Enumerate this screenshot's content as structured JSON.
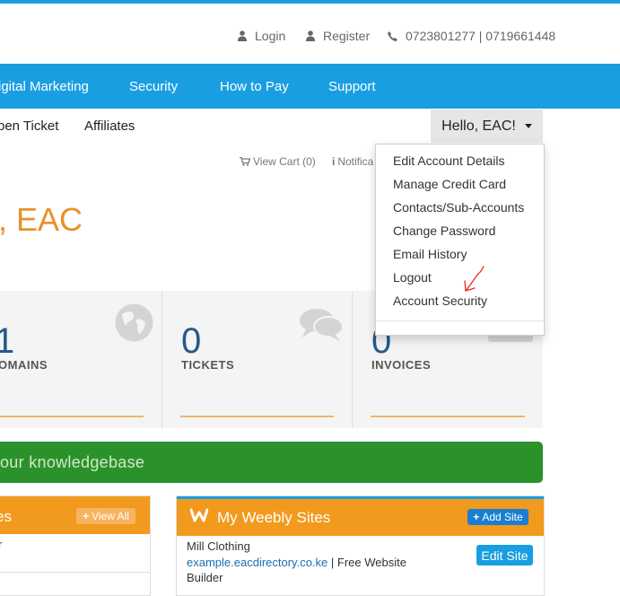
{
  "top_links": {
    "login": "Login",
    "register": "Register",
    "phone": "0723801277 | 0719661448"
  },
  "nav": {
    "items": [
      "igital Marketing",
      "Security",
      "How to Pay",
      "Support"
    ]
  },
  "subnav": {
    "items": [
      "pen Ticket",
      "Affiliates"
    ],
    "user_menu_label": "Hello, EAC!"
  },
  "user_menu": {
    "items": [
      "Edit Account Details",
      "Manage Credit Card",
      "Contacts/Sub-Accounts",
      "Change Password",
      "Email History",
      "Logout",
      "Account Security"
    ]
  },
  "cart": {
    "view_cart": "View Cart (0)",
    "notifications": "Notifica"
  },
  "welcome": ", EAC",
  "stats": [
    {
      "value": "1",
      "label": "OMAINS",
      "icon": "globe-icon"
    },
    {
      "value": "0",
      "label": "TICKETS",
      "icon": "comments-icon"
    },
    {
      "value": "0",
      "label": "INVOICES",
      "icon": "credit-card-icon"
    }
  ],
  "knowledgebase": {
    "text": "our knowledgebase"
  },
  "left_panel": {
    "title": "es",
    "view_all": "View All",
    "first_row": "r"
  },
  "weebly_panel": {
    "title": "My Weebly Sites",
    "add_site": "Add Site",
    "site_name": "Mill Clothing",
    "site_domain": "example.eacdirectory.co.ke",
    "site_sep": " | ",
    "site_type_1": "Free Website",
    "site_type_2": "Builder",
    "edit_site": "Edit Site"
  },
  "colors": {
    "brand_blue": "#1a9ee2",
    "accent_orange": "#f29a1e",
    "kb_green": "#2b922b",
    "annotation_red": "#e8281f"
  }
}
